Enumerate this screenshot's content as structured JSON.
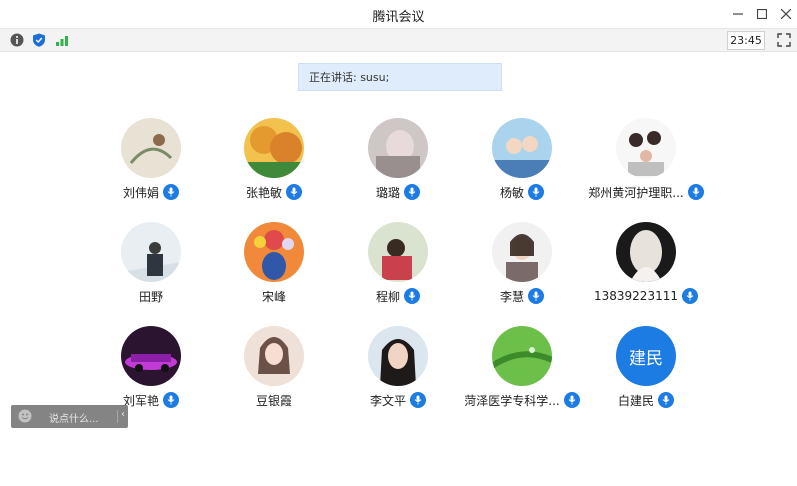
{
  "window": {
    "title": "腾讯会议"
  },
  "toolbar": {
    "time": "23:45"
  },
  "banner": {
    "speaking_text": "正在讲话: susu;"
  },
  "chat": {
    "placeholder": "说点什么..."
  },
  "participants": [
    {
      "name": "刘伟娟",
      "mic": true
    },
    {
      "name": "张艳敏",
      "mic": true
    },
    {
      "name": "璐璐",
      "mic": true
    },
    {
      "name": "杨敏",
      "mic": true
    },
    {
      "name": "郑州黄河护理职...",
      "mic": true
    },
    {
      "name": "田野",
      "mic": false
    },
    {
      "name": "宋峰",
      "mic": false
    },
    {
      "name": "程柳",
      "mic": true
    },
    {
      "name": "李慧",
      "mic": true
    },
    {
      "name": "13839223111",
      "mic": true
    },
    {
      "name": "刘军艳",
      "mic": true
    },
    {
      "name": "豆银霞",
      "mic": false
    },
    {
      "name": "李文平",
      "mic": true
    },
    {
      "name": "菏泽医学专科学...",
      "mic": true
    },
    {
      "name": "白建民",
      "mic": true,
      "avatar_text": "建民"
    }
  ],
  "colors": {
    "accent": "#1d7be4",
    "banner_bg": "#deecfb",
    "mic": "#1d7be4"
  }
}
